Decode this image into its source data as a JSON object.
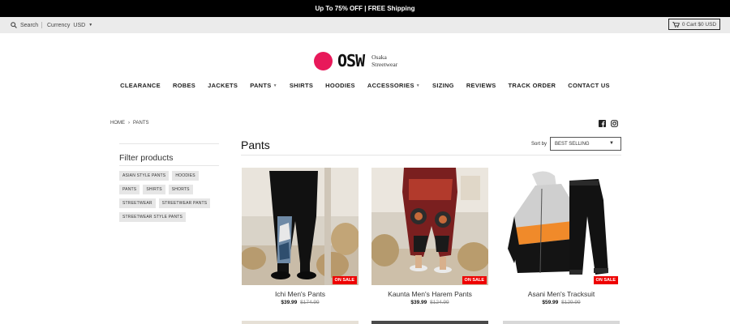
{
  "announcement": "Up To 75% OFF | FREE Shipping",
  "utility": {
    "search_label": "Search",
    "currency_label": "Currency",
    "currency_value": "USD",
    "cart_label": "0 Cart $0 USD"
  },
  "brand": {
    "mark": "OSW",
    "name_line1": "Osaka",
    "name_line2": "Streetwear",
    "accent": "#e8195a"
  },
  "nav": [
    {
      "label": "CLEARANCE"
    },
    {
      "label": "ROBES"
    },
    {
      "label": "JACKETS"
    },
    {
      "label": "PANTS",
      "dropdown": true
    },
    {
      "label": "SHIRTS"
    },
    {
      "label": "HOODIES"
    },
    {
      "label": "ACCESSORIES",
      "dropdown": true
    },
    {
      "label": "SIZING"
    },
    {
      "label": "REVIEWS"
    },
    {
      "label": "TRACK ORDER"
    },
    {
      "label": "CONTACT US"
    }
  ],
  "breadcrumb": {
    "home": "HOME",
    "separator": "›",
    "current": "PANTS"
  },
  "filter": {
    "title": "Filter products",
    "tags": [
      "ASIAN STYLE PANTS",
      "HOODIES",
      "PANTS",
      "SHIRTS",
      "SHORTS",
      "STREETWEAR",
      "STREETWEAR PANTS",
      "STREETWEAR STYLE PANTS"
    ]
  },
  "collection": {
    "title": "Pants",
    "sort_label": "Sort by",
    "sort_value": "BEST SELLING"
  },
  "products": [
    {
      "name": "Ichi Men's Pants",
      "price": "$39.99",
      "compare": "$174.99",
      "badge": "ON SALE"
    },
    {
      "name": "Kaunta Men's Harem Pants",
      "price": "$39.99",
      "compare": "$124.99",
      "badge": "ON SALE"
    },
    {
      "name": "Asani Men's Tracksuit",
      "price": "$59.99",
      "compare": "$129.99",
      "badge": "ON SALE"
    }
  ],
  "icons": [
    "search-icon",
    "cart-icon",
    "facebook-icon",
    "instagram-icon",
    "chevron-down-icon"
  ]
}
